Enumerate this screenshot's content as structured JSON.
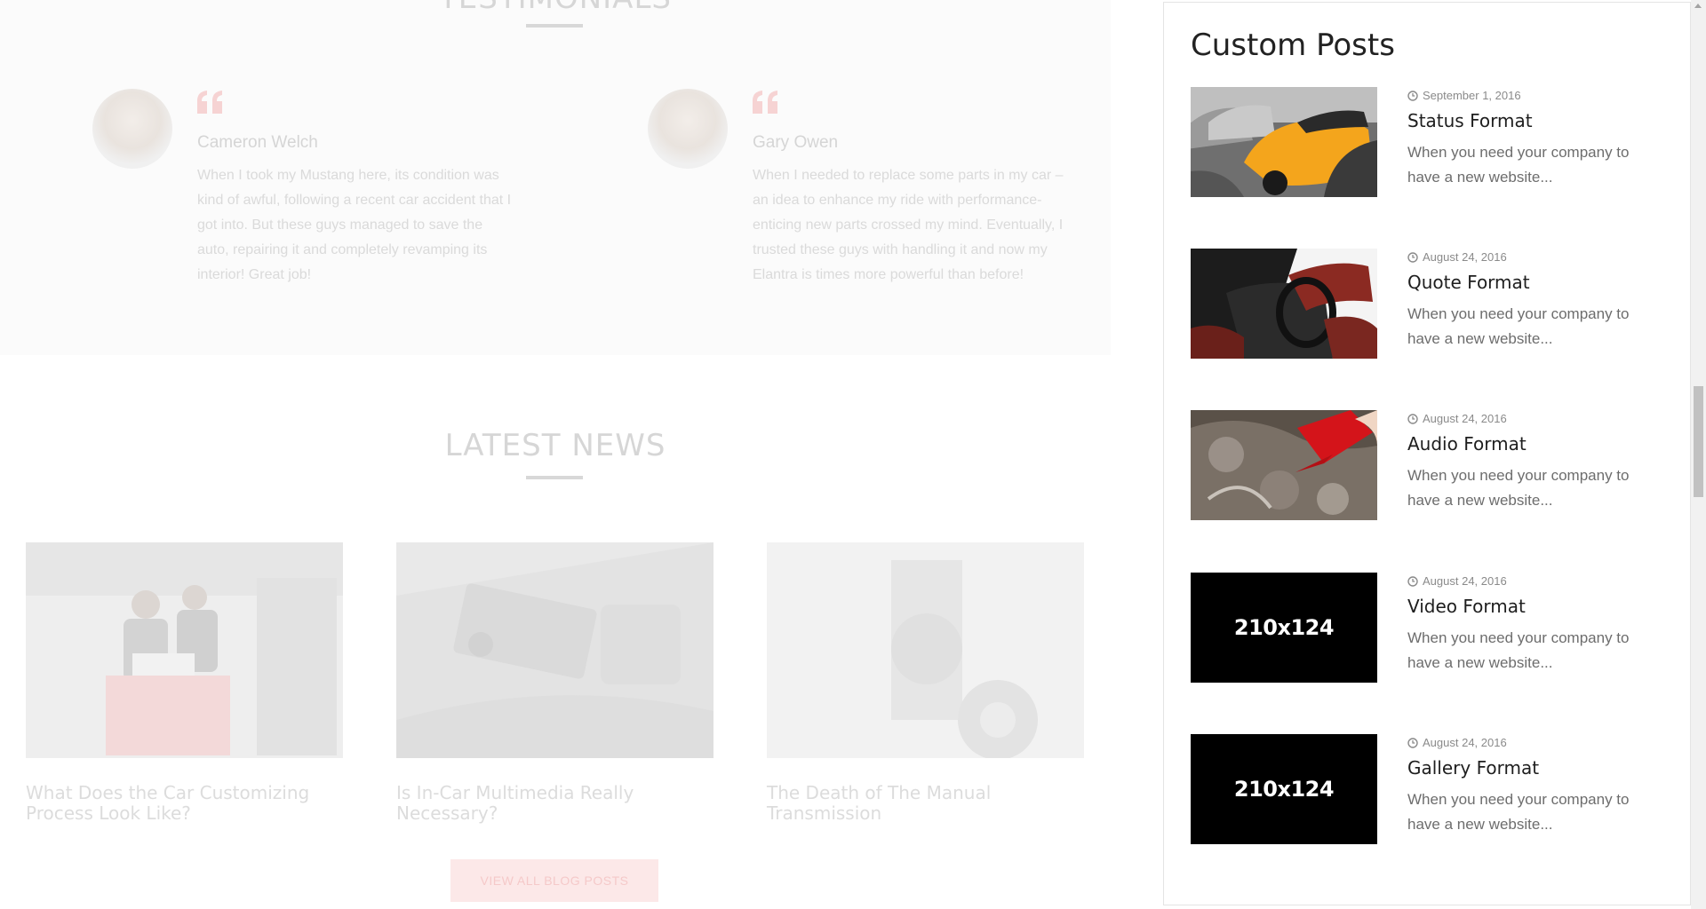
{
  "background": {
    "testimonials_title": "TESTIMONIALS",
    "testimonials": [
      {
        "name": "Cameron Welch",
        "text": "When I took my Mustang here, its condition was kind of awful, following a recent car accident that I got into. But these guys managed to save the auto, repairing it and completely revamping its interior! Great job!"
      },
      {
        "name": "Gary Owen",
        "text": "When I needed to replace some parts in my car – an idea to enhance my ride with performance-enticing new parts crossed my mind. Eventually, I trusted these guys with handling it and now my Elantra is times more powerful than before!"
      }
    ],
    "news_title": "LATEST NEWS",
    "news": [
      {
        "title": "What Does the Car Customizing Process Look Like?"
      },
      {
        "title": "Is In-Car Multimedia Really Necessary?"
      },
      {
        "title": "The Death of The Manual Transmission"
      }
    ],
    "view_all_label": "VIEW ALL BLOG POSTS"
  },
  "panel": {
    "title": "Custom Posts",
    "posts": [
      {
        "date": "September 1, 2016",
        "title": "Status Format",
        "excerpt": "When you need your company to have a new website...",
        "thumb": "orange-car-photo"
      },
      {
        "date": "August 24, 2016",
        "title": "Quote Format",
        "excerpt": "When you need your company to have a new website...",
        "thumb": "car-interior-photo"
      },
      {
        "date": "August 24, 2016",
        "title": "Audio Format",
        "excerpt": "When you need your company to have a new website...",
        "thumb": "engine-oil-photo"
      },
      {
        "date": "August 24, 2016",
        "title": "Video Format",
        "excerpt": "When you need your company to have a new website...",
        "thumb": "placeholder",
        "placeholder_text": "210x124"
      },
      {
        "date": "August 24, 2016",
        "title": "Gallery Format",
        "excerpt": "When you need your company to have a new website...",
        "thumb": "placeholder",
        "placeholder_text": "210x124"
      }
    ]
  },
  "colors": {
    "accent": "#f3b9b9",
    "text_dark": "#1e1e1e",
    "meta_gray": "#8a8a8a"
  }
}
